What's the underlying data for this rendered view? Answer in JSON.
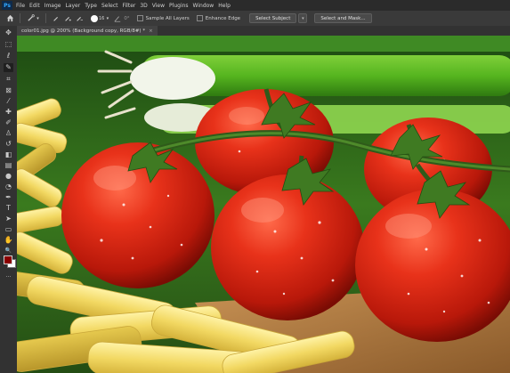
{
  "app": {
    "logo_text": "Ps"
  },
  "menu": [
    "File",
    "Edit",
    "Image",
    "Layer",
    "Type",
    "Select",
    "Filter",
    "3D",
    "View",
    "Plugins",
    "Window",
    "Help"
  ],
  "options_bar": {
    "home_icon": "home-icon",
    "tool_icon": "quick-selection-icon",
    "brush_size": "16",
    "angle_label": "0°",
    "sample_all_layers_label": "Sample All Layers",
    "sample_all_layers_checked": false,
    "enhance_edge_label": "Enhance Edge",
    "enhance_edge_checked": false,
    "select_subject_label": "Select Subject",
    "select_and_mask_label": "Select and Mask..."
  },
  "document_tab": {
    "title": "color01.jpg @ 200% (Background copy, RGB/8#) *",
    "close": "×"
  },
  "tools": [
    {
      "name": "move-icon",
      "glyph": "✥"
    },
    {
      "name": "marquee-icon",
      "glyph": "⬚"
    },
    {
      "name": "lasso-icon",
      "glyph": "ℓ"
    },
    {
      "name": "quick-selection-icon",
      "glyph": "✎"
    },
    {
      "name": "crop-icon",
      "glyph": "⌗"
    },
    {
      "name": "frame-icon",
      "glyph": "⊠"
    },
    {
      "name": "eyedropper-icon",
      "glyph": "⁄"
    },
    {
      "name": "healing-brush-icon",
      "glyph": "✚"
    },
    {
      "name": "brush-icon",
      "glyph": "✐"
    },
    {
      "name": "clone-stamp-icon",
      "glyph": "♙"
    },
    {
      "name": "history-brush-icon",
      "glyph": "↺"
    },
    {
      "name": "eraser-icon",
      "glyph": "◧"
    },
    {
      "name": "gradient-icon",
      "glyph": "▤"
    },
    {
      "name": "blur-icon",
      "glyph": "●"
    },
    {
      "name": "dodge-icon",
      "glyph": "◔"
    },
    {
      "name": "pen-icon",
      "glyph": "✒"
    },
    {
      "name": "type-icon",
      "glyph": "T"
    },
    {
      "name": "path-selection-icon",
      "glyph": "➤"
    },
    {
      "name": "rectangle-icon",
      "glyph": "▭"
    },
    {
      "name": "hand-icon",
      "glyph": "✋"
    },
    {
      "name": "zoom-icon",
      "glyph": "🔍"
    },
    {
      "name": "more-tools-icon",
      "glyph": "···"
    }
  ],
  "colors": {
    "foreground": "#8b0000",
    "background": "#ffffff",
    "ps_blue": "#31a8ff"
  }
}
